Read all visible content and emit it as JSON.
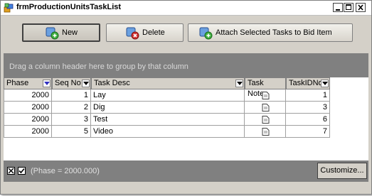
{
  "window": {
    "title": "frmProductionUnitsTaskList",
    "icon": "app-icon"
  },
  "toolbar": {
    "new_label": "New",
    "delete_label": "Delete",
    "attach_label": "Attach Selected Tasks to Bid Item"
  },
  "groupbar": {
    "hint": "Drag a column header here to group by that column"
  },
  "grid": {
    "columns": [
      "Phase",
      "Seq No",
      "Task Desc",
      "Task Notes",
      "TaskIDNo"
    ],
    "rows": [
      {
        "phase": "2000",
        "seq": "1",
        "desc": "Lay",
        "id": "1"
      },
      {
        "phase": "2000",
        "seq": "2",
        "desc": "Dig",
        "id": "3"
      },
      {
        "phase": "2000",
        "seq": "3",
        "desc": "Test",
        "id": "6"
      },
      {
        "phase": "2000",
        "seq": "5",
        "desc": "Video",
        "id": "7"
      }
    ]
  },
  "filter": {
    "text": "(Phase = 2000.000)",
    "customize_label": "Customize..."
  },
  "colors": {
    "groupbar": "#808080",
    "header": "#d4d0c8",
    "filter_arrow": "#3030c0"
  }
}
